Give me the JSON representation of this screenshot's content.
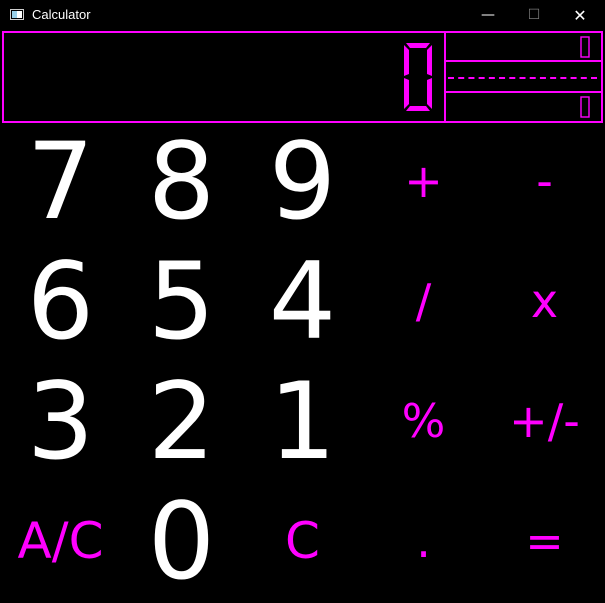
{
  "window": {
    "title": "Calculator",
    "minimize_glyph": "—",
    "maximize_glyph": "☐",
    "close_glyph": "✕"
  },
  "display": {
    "main_value": "0",
    "upper_value": "0",
    "lower_value": "0"
  },
  "colors": {
    "accent": "#ff00ff",
    "digits": "#ffffff",
    "background": "#000000"
  },
  "keys": {
    "k7": "7",
    "k8": "8",
    "k9": "9",
    "add": "+",
    "subtract": "-",
    "k6": "6",
    "k5": "5",
    "k4": "4",
    "divide": "/",
    "multiply": "x",
    "k3": "3",
    "k2": "2",
    "k1": "1",
    "percent": "%",
    "negate": "+/-",
    "all_clear": "A/C",
    "k0": "0",
    "clear": "C",
    "decimal": ".",
    "equals": "="
  }
}
